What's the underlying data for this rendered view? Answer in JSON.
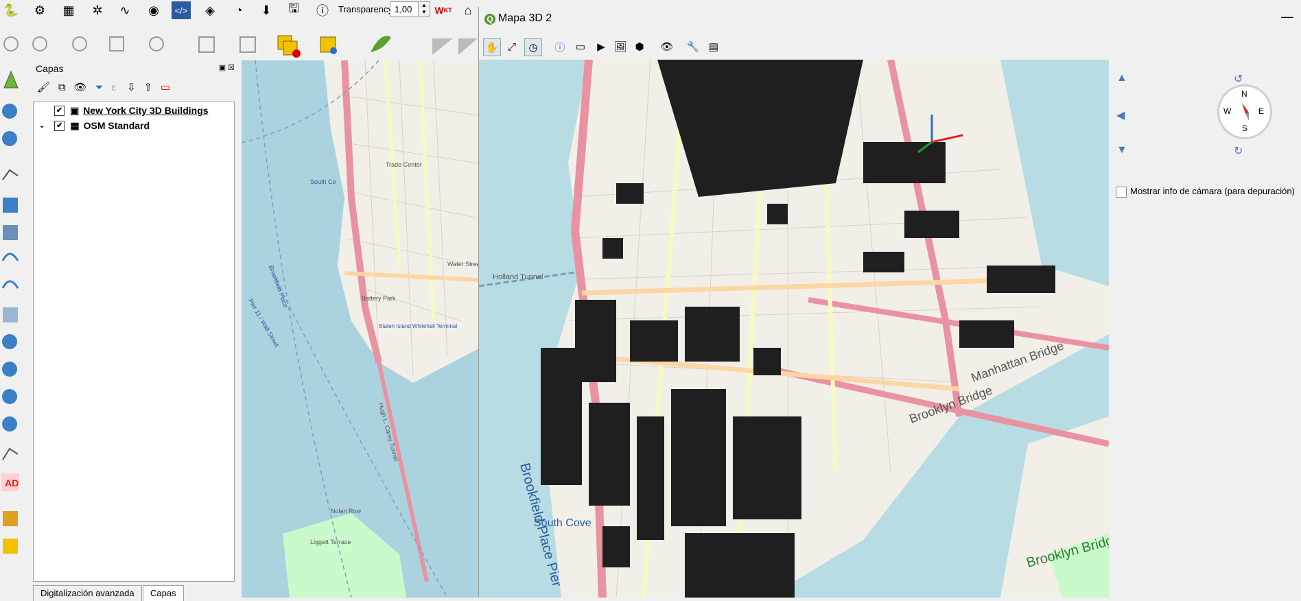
{
  "toolbar": {
    "transparency_label": "Transparency",
    "transparency_value": "1,00"
  },
  "layers_panel": {
    "title": "Capas",
    "layers": [
      {
        "name": "New York City 3D Buildings",
        "checked": true
      },
      {
        "name": "OSM Standard",
        "checked": true
      }
    ],
    "tabs": [
      "Digitalización avanzada",
      "Capas"
    ],
    "left_toolbar_badge": "AD"
  },
  "map2d": {
    "labels": [
      "Trade Center",
      "Water Street",
      "South Co",
      "Brookfield Place",
      "Pier 11 / Wall Street",
      "Staten Island Whitehall Terminal",
      "Hugh L. Carey Tunnel",
      "Battery Park",
      "Liggett Terrace",
      "Nolan Row"
    ]
  },
  "window3d": {
    "title": "Mapa 3D 2",
    "compass": {
      "n": "N",
      "s": "S",
      "e": "E",
      "w": "W"
    },
    "camera_info_label": "Mostrar info de cámara (para depuración)",
    "map_labels": [
      "Holland Tunnel",
      "Brookfield Place Pier",
      "Manhattan Bridge",
      "Brooklyn Bridge",
      "Brooklyn Bridge Park",
      "South Cove"
    ]
  },
  "colors": {
    "water": "#aad3df",
    "land": "#f2efe9",
    "road_major": "#e892a2",
    "road_secondary": "#f7fabf",
    "road_primary": "#fcd6a4",
    "buildings": "#1f1f1f",
    "park": "#c8facc",
    "qgis_green": "#589632"
  }
}
